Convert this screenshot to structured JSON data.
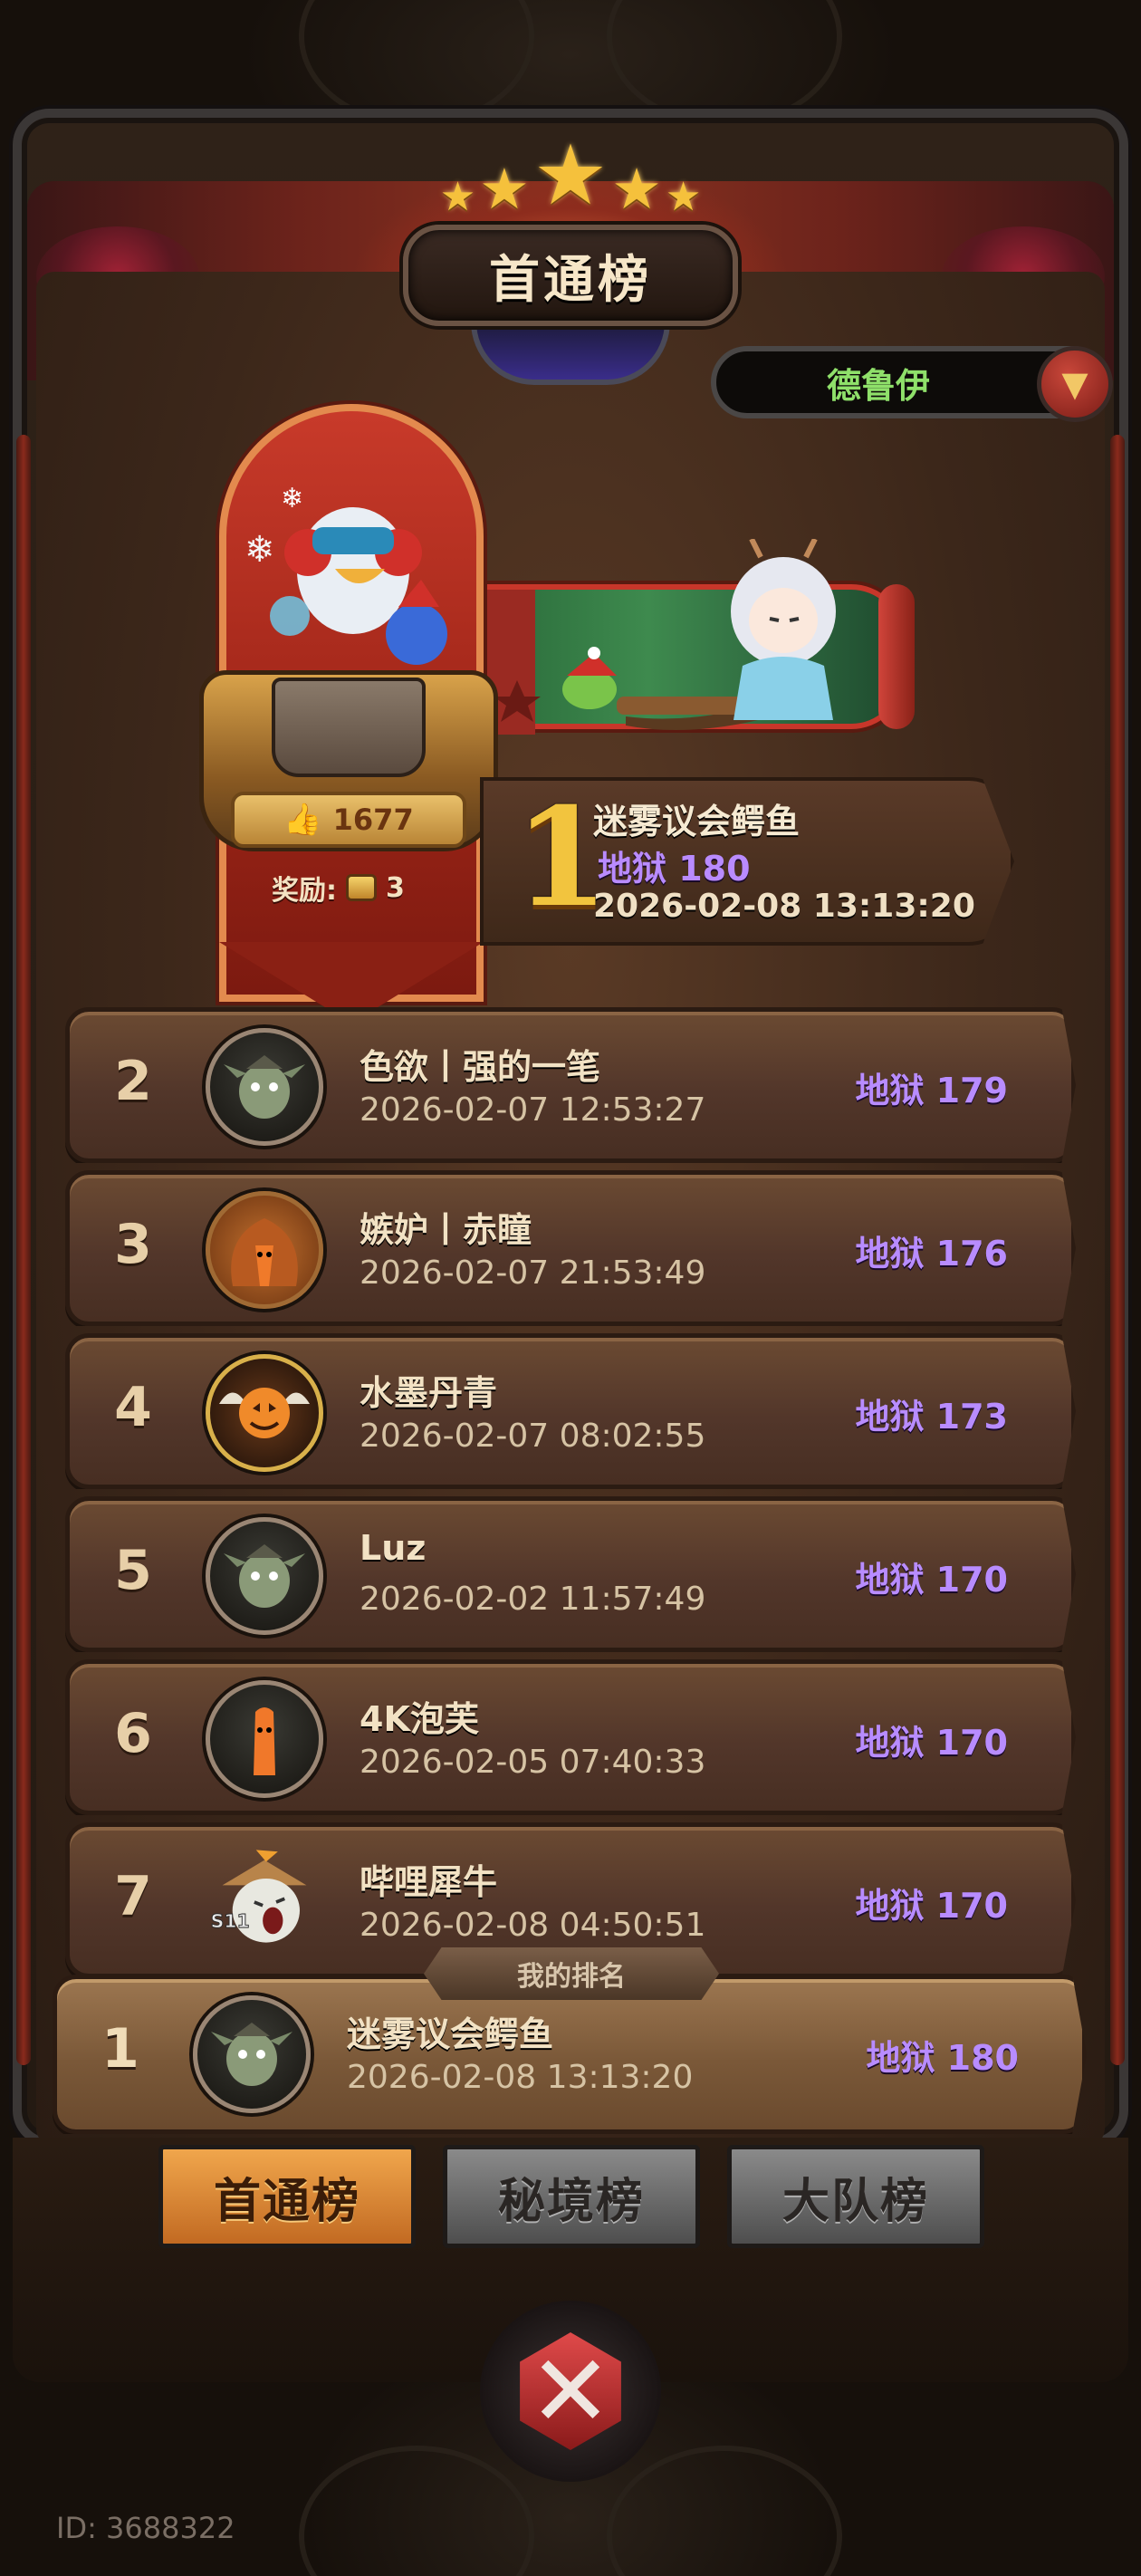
{
  "header": {
    "title": "首通榜",
    "star_count": 5
  },
  "class_select": {
    "value": "德鲁伊"
  },
  "champion": {
    "likes": "1677",
    "reward_label": "奖励:",
    "reward_count": "3",
    "rank": "1",
    "name": "迷雾议会鳄鱼",
    "score": "地狱 180",
    "date": "2026-02-08 13:13:20"
  },
  "rows": [
    {
      "rank": "2",
      "name": "色欲丨强的一笔",
      "date": "2026-02-07 12:53:27",
      "score": "地狱 179",
      "avatar": "goblin-avatar"
    },
    {
      "rank": "3",
      "name": "嫉妒丨赤瞳",
      "date": "2026-02-07 21:53:49",
      "score": "地狱 176",
      "avatar": "carrot-sack-avatar"
    },
    {
      "rank": "4",
      "name": "水墨丹青",
      "date": "2026-02-07 08:02:55",
      "score": "地狱 173",
      "avatar": "pumpkin-wings-avatar"
    },
    {
      "rank": "5",
      "name": "Luz",
      "date": "2026-02-02 11:57:49",
      "score": "地狱 170",
      "avatar": "goblin-avatar"
    },
    {
      "rank": "6",
      "name": "4K泡芙",
      "date": "2026-02-05 07:40:33",
      "score": "地狱 170",
      "avatar": "carrot-avatar"
    },
    {
      "rank": "7",
      "name": "哔哩犀牛",
      "date": "2026-02-08 04:50:51",
      "score": "地狱 170",
      "avatar": "ghost-hat-avatar",
      "badge": "S11"
    }
  ],
  "my_rank": {
    "tag": "我的排名",
    "rank": "1",
    "name": "迷雾议会鳄鱼",
    "date": "2026-02-08 13:13:20",
    "score": "地狱 180"
  },
  "tabs": [
    {
      "label": "首通榜",
      "active": true
    },
    {
      "label": "秘境榜",
      "active": false
    },
    {
      "label": "大队榜",
      "active": false
    }
  ],
  "footer": {
    "player_id": "ID: 3688322"
  },
  "colors": {
    "score_purple": "#b88cff",
    "rank_gold": "#f2c43e",
    "class_green": "#8fe06a",
    "tab_active": "#e08a3a"
  }
}
